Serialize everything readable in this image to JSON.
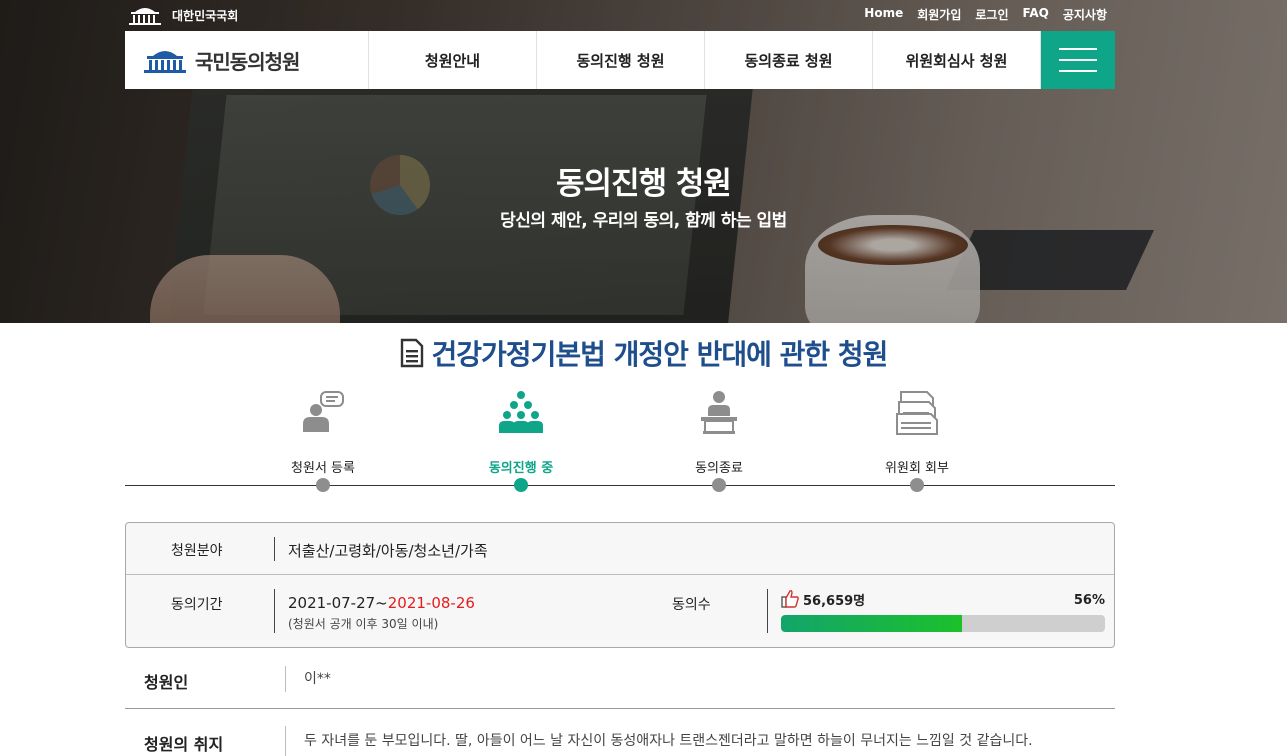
{
  "header": {
    "assembly_name": "대한민국국회",
    "util_links": [
      "Home",
      "회원가입",
      "로그인",
      "FAQ",
      "공지사항"
    ],
    "brand": "국민동의청원",
    "menu": [
      "청원안내",
      "동의진행 청원",
      "동의종료 청원",
      "위원회심사 청원"
    ]
  },
  "hero": {
    "title": "동의진행 청원",
    "subtitle": "당신의 제안, 우리의 동의, 함께 하는 입법"
  },
  "petition": {
    "title": "건강가정기본법 개정안 반대에 관한 청원"
  },
  "steps": [
    {
      "label": "청원서 등록",
      "icon": "speaker-bubble-icon",
      "active": false
    },
    {
      "label": "동의진행 중",
      "icon": "crowd-icon",
      "active": true
    },
    {
      "label": "동의종료",
      "icon": "podium-person-icon",
      "active": false
    },
    {
      "label": "위원회 회부",
      "icon": "document-stack-icon",
      "active": false
    }
  ],
  "info": {
    "field_label": "청원분야",
    "field_value": "저출산/고령화/아동/청소년/가족",
    "period_label": "동의기간",
    "period_start": "2021-07-27~",
    "period_end": "2021-08-26",
    "period_note": "(청원서 공개 이후 30일 이내)",
    "agree_label": "동의수",
    "agree_count": "56,659명",
    "agree_percent": "56%",
    "agree_fraction": 0.56
  },
  "details": {
    "petitioner_label": "청원인",
    "petitioner_value": "이**",
    "purpose_label": "청원의 취지",
    "purpose_value": "두 자녀를 둔 부모입니다. 딸, 아들이 어느 날 자신이 동성애자나 트랜스젠더라고 말하면 하늘이 무너지는 느낌일 것 같습니다."
  },
  "colors": {
    "accent": "#0fa589",
    "title_blue": "#1f4e8c",
    "end_date_red": "#e51c1c",
    "bar_green": "#1cc02a"
  }
}
